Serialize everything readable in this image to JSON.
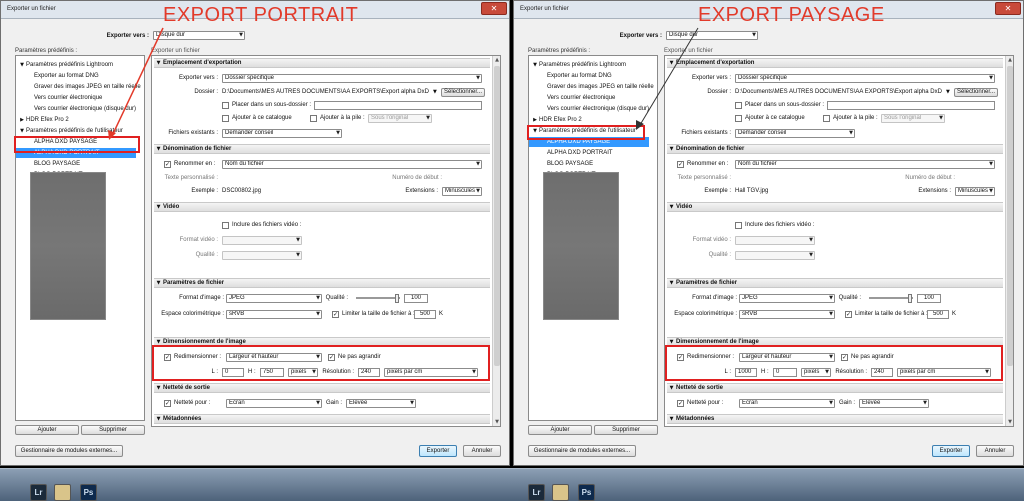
{
  "annotations": [
    "EXPORT PORTRAIT",
    "EXPORT PAYSAGE"
  ],
  "dialogs": [
    {
      "title": "Exporter un fichier",
      "export_to_label": "Exporter vers :",
      "export_to_value": "Disque dur",
      "presets_label": "Paramètres prédéfinis :",
      "subheading": "Exporter un fichier",
      "presets": [
        {
          "text": "Paramètres prédéfinis Lightroom",
          "kind": "group"
        },
        {
          "text": "Exporter au format DNG",
          "kind": "item"
        },
        {
          "text": "Graver des images JPEG en taille réelle",
          "kind": "item"
        },
        {
          "text": "Vers courrier électronique",
          "kind": "item"
        },
        {
          "text": "Vers courrier électronique (disque dur)",
          "kind": "item"
        },
        {
          "text": "HDR Efex Pro 2",
          "kind": "group-collapsed"
        },
        {
          "text": "Paramètres prédéfinis de l'utilisateur",
          "kind": "group"
        },
        {
          "text": "ALPHA DXD PAYSAGE",
          "kind": "item"
        },
        {
          "text": "ALPHA DXD PORTRAIT",
          "kind": "selected"
        },
        {
          "text": "BLOG PAYSAGE",
          "kind": "item"
        },
        {
          "text": "BLOG PORTRAIT",
          "kind": "item"
        }
      ],
      "add_button": "Ajouter",
      "remove_button": "Supprimer",
      "plugins_button": "Gestionnaire de modules externes...",
      "export_button": "Exporter",
      "cancel_button": "Annuler",
      "location": {
        "header": "Emplacement d'exportation",
        "export_to_label": "Exporter vers :",
        "export_to_value": "Dossier spécifique",
        "folder_label": "Dossier :",
        "folder_value": "D:\\Documents\\MES AUTRES DOCUMENTS\\AA  EXPORTS\\Export alpha DxD",
        "select_button": "Sélectionner...",
        "subfolder_label": "Placer dans un sous-dossier :",
        "add_catalog_label": "Ajouter à ce catalogue",
        "add_stack_label": "Ajouter à la pile :",
        "stack_value": "Sous l'original",
        "existing_label": "Fichiers existants :",
        "existing_value": "Demander conseil"
      },
      "naming": {
        "header": "Dénomination de fichier",
        "rename_label": "Renommer en :",
        "rename_value": "Nom du fichier",
        "custom_text_label": "Texte personnalisé :",
        "start_number_label": "Numéro de début :",
        "example_label": "Exemple :",
        "example_value": "DSC00802.jpg",
        "extensions_label": "Extensions :",
        "extensions_value": "Minuscules"
      },
      "video": {
        "header": "Vidéo",
        "include_label": "Inclure des fichiers vidéo :",
        "format_label": "Format vidéo :",
        "quality_label": "Qualité :"
      },
      "file_settings": {
        "header": "Paramètres de fichier",
        "format_label": "Format d'image :",
        "format_value": "JPEG",
        "quality_label": "Qualité :",
        "quality_value": "100",
        "quality_level": 1.0,
        "colorspace_label": "Espace colorimétrique :",
        "colorspace_value": "sRVB",
        "limit_label": "Limiter la taille de fichier à :",
        "limit_value": "500",
        "limit_unit": "K"
      },
      "sizing": {
        "header": "Dimensionnement de l'image",
        "resize_label": "Redimensionner :",
        "resize_value": "Largeur et hauteur",
        "no_enlarge_label": "Ne pas agrandir",
        "w_label": "L :",
        "w_value": "0",
        "h_label": "H :",
        "h_value": "750",
        "unit_value": "pixels",
        "resolution_label": "Résolution :",
        "resolution_value": "240",
        "resolution_unit": "pixels par cm"
      },
      "sharpening": {
        "header": "Netteté de sortie",
        "sharpen_label": "Netteté pour :",
        "sharpen_value": "Ecran",
        "amount_label": "Gain :",
        "amount_value": "Elevée"
      },
      "metadata": {
        "header": "Métadonnées"
      }
    },
    {
      "title": "Exporter un fichier",
      "export_to_label": "Exporter vers :",
      "export_to_value": "Disque dur",
      "presets_label": "Paramètres prédéfinis :",
      "subheading": "Exporter un fichier",
      "presets": [
        {
          "text": "Paramètres prédéfinis Lightroom",
          "kind": "group"
        },
        {
          "text": "Exporter au format DNG",
          "kind": "item"
        },
        {
          "text": "Graver des images JPEG en taille réelle",
          "kind": "item"
        },
        {
          "text": "Vers courrier électronique",
          "kind": "item"
        },
        {
          "text": "Vers courrier électronique (disque dur)",
          "kind": "item"
        },
        {
          "text": "HDR Efex Pro 2",
          "kind": "group-collapsed"
        },
        {
          "text": "Paramètres prédéfinis de l'utilisateur",
          "kind": "group"
        },
        {
          "text": "ALPHA DXD PAYSAGE",
          "kind": "selected"
        },
        {
          "text": "ALPHA DXD PORTRAIT",
          "kind": "item"
        },
        {
          "text": "BLOG PAYSAGE",
          "kind": "item"
        },
        {
          "text": "BLOG PORTRAIT",
          "kind": "item"
        }
      ],
      "add_button": "Ajouter",
      "remove_button": "Supprimer",
      "plugins_button": "Gestionnaire de modules externes...",
      "export_button": "Exporter",
      "cancel_button": "Annuler",
      "location": {
        "header": "Emplacement d'exportation",
        "export_to_label": "Exporter vers :",
        "export_to_value": "Dossier spécifique",
        "folder_label": "Dossier :",
        "folder_value": "D:\\Documents\\MES AUTRES DOCUMENTS\\AA  EXPORTS\\Export alpha DxD",
        "select_button": "Sélectionner...",
        "subfolder_label": "Placer dans un sous-dossier :",
        "add_catalog_label": "Ajouter à ce catalogue",
        "add_stack_label": "Ajouter à la pile :",
        "stack_value": "Sous l'original",
        "existing_label": "Fichiers existants :",
        "existing_value": "Demander conseil"
      },
      "naming": {
        "header": "Dénomination de fichier",
        "rename_label": "Renommer en :",
        "rename_value": "Nom du fichier",
        "custom_text_label": "Texte personnalisé :",
        "start_number_label": "Numéro de début :",
        "example_label": "Exemple :",
        "example_value": "Hall TGV.jpg",
        "extensions_label": "Extensions :",
        "extensions_value": "Minuscules"
      },
      "video": {
        "header": "Vidéo",
        "include_label": "Inclure des fichiers vidéo :",
        "format_label": "Format vidéo :",
        "quality_label": "Qualité :"
      },
      "file_settings": {
        "header": "Paramètres de fichier",
        "format_label": "Format d'image :",
        "format_value": "JPEG",
        "quality_label": "Qualité :",
        "quality_value": "100",
        "quality_level": 1.0,
        "colorspace_label": "Espace colorimétrique :",
        "colorspace_value": "sRVB",
        "limit_label": "Limiter la taille de fichier à :",
        "limit_value": "500",
        "limit_unit": "K"
      },
      "sizing": {
        "header": "Dimensionnement de l'image",
        "resize_label": "Redimensionner :",
        "resize_value": "Largeur et hauteur",
        "no_enlarge_label": "Ne pas agrandir",
        "w_label": "L :",
        "w_value": "1000",
        "h_label": "H :",
        "h_value": "0",
        "unit_value": "pixels",
        "resolution_label": "Résolution :",
        "resolution_value": "240",
        "resolution_unit": "pixels par cm"
      },
      "sharpening": {
        "header": "Netteté de sortie",
        "sharpen_label": "Netteté pour :",
        "sharpen_value": "Ecran",
        "amount_label": "Gain :",
        "amount_value": "Elevée"
      },
      "metadata": {
        "header": "Métadonnées"
      }
    }
  ],
  "taskbar": {
    "icons": [
      {
        "name": "lightroom-icon",
        "text": "Lr"
      },
      {
        "name": "file-icon",
        "text": ""
      },
      {
        "name": "photoshop-icon",
        "text": "Ps"
      }
    ]
  },
  "colors": {
    "annotation": "#e23a2a",
    "selection": "#3399ff",
    "highlight_box": "#e02020"
  }
}
